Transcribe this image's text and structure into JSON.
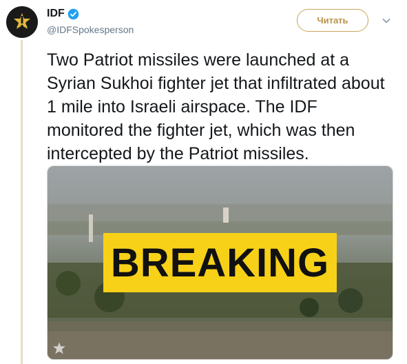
{
  "tweet": {
    "author": {
      "display_name": "IDF",
      "handle": "@IDFSpokesperson",
      "verified": true,
      "avatar_icon": "idf-emblem-icon"
    },
    "follow_label": "Читать",
    "menu_icon": "chevron-down-icon",
    "text": "Two Patriot missiles were launched at a Syrian Sukhoi fighter jet that infiltrated about 1 mile into Israeli airspace. The IDF monitored the fighter jet, which was then intercepted by the Patriot missiles.",
    "media": {
      "banner_text": "BREAKING",
      "banner_color": "#f7d117",
      "logo_icon": "idf-emblem-icon"
    }
  },
  "colors": {
    "accent": "#c8a45a",
    "verified": "#1da1f2",
    "thread_line": "#e6dfc6"
  }
}
